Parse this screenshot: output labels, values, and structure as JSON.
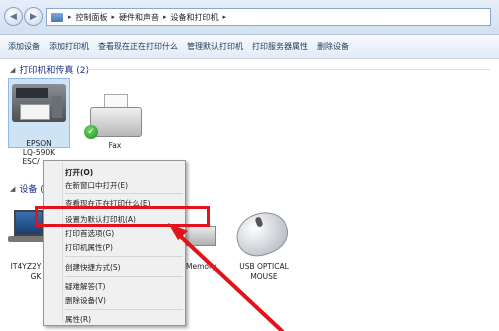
{
  "address_bar": {
    "crumbs": [
      "控制面板",
      "硬件和声音",
      "设备和打印机"
    ]
  },
  "command_bar": {
    "items": [
      "添加设备",
      "添加打印机",
      "查看现在正在打印什么",
      "管理默认打印机",
      "打印服务器属性",
      "删除设备"
    ]
  },
  "printers_group": {
    "title": "打印机和传真 (2)",
    "items": [
      {
        "name": "EPSON LQ-590K ESC/P",
        "label_lines": [
          "EPSON",
          "LQ-590K",
          "ESC/"
        ]
      },
      {
        "name": "Fax",
        "label_lines": [
          "Fax"
        ]
      }
    ]
  },
  "devices_group": {
    "title": "设备 (4",
    "items": [
      {
        "label_lines": [
          "IT4YZ2Y",
          "GK"
        ]
      },
      {
        "label_lines": [
          "Memory"
        ]
      },
      {
        "label_lines": [
          "USB OPTICAL",
          "MOUSE"
        ]
      }
    ]
  },
  "context_menu": {
    "items": [
      {
        "label": "打开(O)",
        "bold": true
      },
      {
        "label": "在新窗口中打开(E)"
      },
      {
        "label": "查看现在正在打印什么(E)"
      },
      {
        "label": "设置为默认打印机(A)",
        "highlighted": true
      },
      {
        "label": "打印首选项(G)"
      },
      {
        "label": "打印机属性(P)"
      },
      {
        "label": "创建快捷方式(S)"
      },
      {
        "label": "疑难解答(T)"
      },
      {
        "label": "删除设备(V)"
      },
      {
        "label": "属性(R)"
      }
    ]
  },
  "colors": {
    "highlight_border": "#e4131b",
    "arrow": "#e4131b",
    "group_title": "#1e3287"
  }
}
